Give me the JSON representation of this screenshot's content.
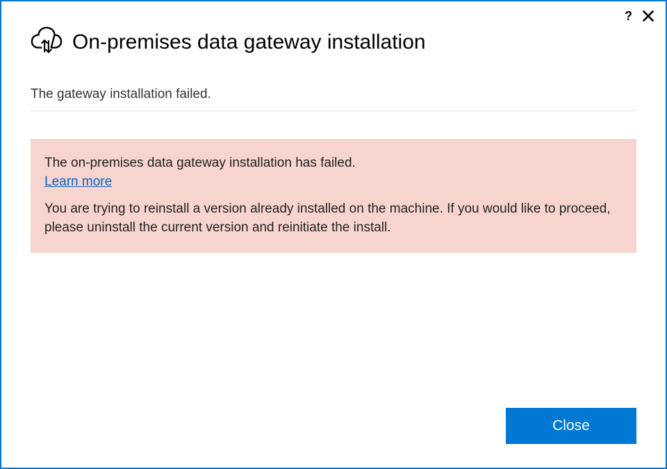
{
  "header": {
    "title": "On-premises data gateway installation"
  },
  "status": {
    "text": "The gateway installation failed."
  },
  "error": {
    "title": "The on-premises data gateway installation has failed.",
    "learn_more": "Learn more",
    "detail": "You are trying to reinstall a version already installed on the machine. If you would like to proceed, please uninstall the current version and reinitiate the install."
  },
  "footer": {
    "close_label": "Close"
  },
  "titlebar": {
    "help": "?"
  }
}
